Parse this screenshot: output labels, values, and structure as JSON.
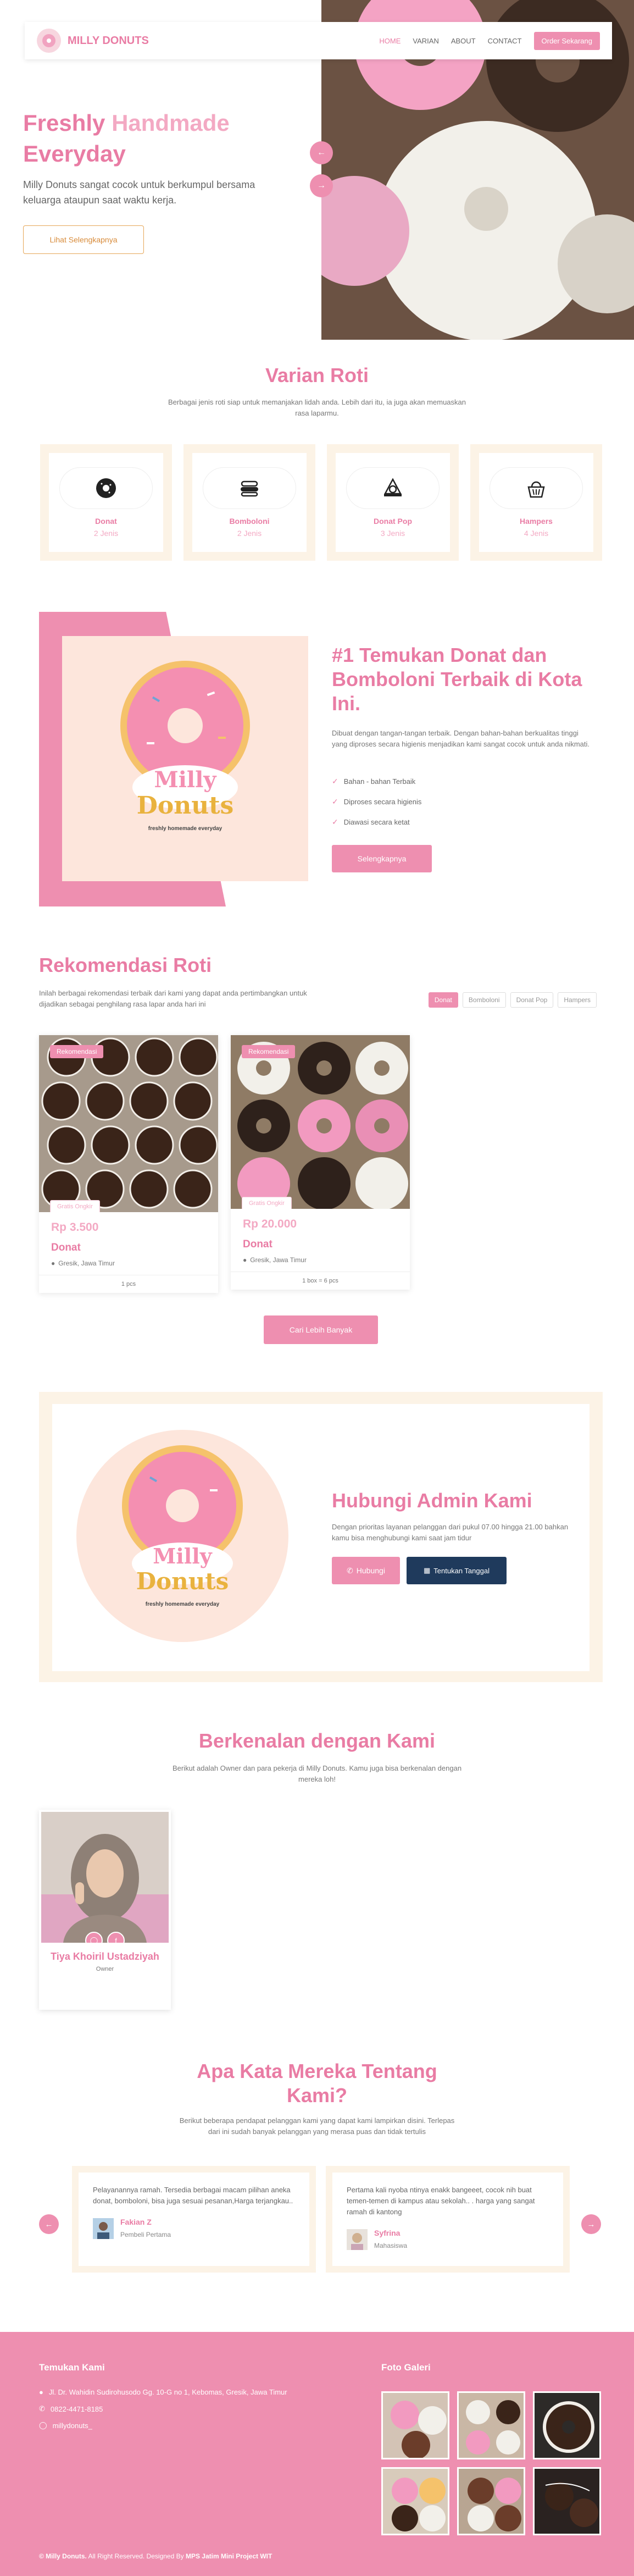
{
  "nav": {
    "brand": "MILLY DONUTS",
    "links": [
      "HOME",
      "VARIAN",
      "ABOUT",
      "CONTACT"
    ],
    "order_label": "Order Sekarang"
  },
  "hero": {
    "title_line1_a": "Freshly",
    "title_line1_b": "Handmade",
    "title_line2": "Everyday",
    "description": "Milly Donuts sangat cocok untuk berkumpul bersama keluarga ataupun saat waktu kerja.",
    "cta": "Lihat Selengkapnya"
  },
  "varian": {
    "title": "Varian Roti",
    "subtitle": "Berbagai jenis roti siap untuk memanjakan lidah anda. Lebih dari itu, ia juga akan memuaskan rasa laparmu.",
    "items": [
      {
        "name": "Donat",
        "count": "2 Jenis",
        "icon": "donut-icon"
      },
      {
        "name": "Bomboloni",
        "count": "2 Jenis",
        "icon": "bomboloni-icon"
      },
      {
        "name": "Donat Pop",
        "count": "3 Jenis",
        "icon": "donut-pop-icon"
      },
      {
        "name": "Hampers",
        "count": "4 Jenis",
        "icon": "hampers-icon"
      }
    ]
  },
  "about": {
    "heading": "#1 Temukan Donat dan Bomboloni Terbaik di Kota Ini.",
    "paragraph": "Dibuat dengan tangan-tangan terbaik. Dengan bahan-bahan berkualitas tinggi yang diproses secara higienis menjadikan kami sangat cocok untuk anda nikmati.",
    "checks": [
      "Bahan - bahan Terbaik",
      "Diproses secara higienis",
      "Diawasi secara ketat"
    ],
    "button": "Selengkapnya",
    "logo_text_1": "Milly",
    "logo_text_2": "Donuts",
    "logo_tagline": "freshly homemade everyday"
  },
  "rekomendasi": {
    "title": "Rekomendasi Roti",
    "subtitle": "Inilah berbagai rekomendasi terbaik dari kami yang dapat anda pertimbangkan untuk dijadikan sebagai penghilang rasa lapar anda hari ini",
    "filters": [
      "Donat",
      "Bomboloni",
      "Donat Pop",
      "Hampers"
    ],
    "products": [
      {
        "badge": "Rekomendasi",
        "shipping": "Gratis Ongkir",
        "price": "Rp 3.500",
        "name": "Donat",
        "location": "Gresik, Jawa Timur",
        "unit": "1 pcs"
      },
      {
        "badge": "Rekomendasi",
        "shipping": "Gratis Ongkir",
        "price": "Rp 20.000",
        "name": "Donat",
        "location": "Gresik, Jawa Timur",
        "unit": "1 box = 6 pcs"
      }
    ],
    "more": "Cari Lebih Banyak"
  },
  "contact": {
    "title": "Hubungi Admin Kami",
    "description": "Dengan prioritas layanan pelanggan dari pukul 07.00 hingga 21.00 bahkan kamu bisa menghubungi kami saat jam tidur",
    "call": "Hubungi",
    "date": "Tentukan Tanggal"
  },
  "team": {
    "title": "Berkenalan dengan Kami",
    "subtitle": "Berikut adalah Owner dan para pekerja di Milly Donuts. Kamu juga bisa berkenalan dengan mereka loh!",
    "member_name": "Tiya Khoiril Ustadziyah",
    "member_role": "Owner"
  },
  "testimonials": {
    "title_1": "Apa Kata Mereka Tentang",
    "title_2": "Kami?",
    "subtitle": "Berikut beberapa pendapat pelanggan kami yang dapat kami lampirkan disini. Terlepas dari ini sudah banyak pelanggan yang merasa puas dan tidak tertulis",
    "items": [
      {
        "text": "Pelayanannya ramah. Tersedia berbagai macam pilihan aneka donat, bomboloni, bisa juga sesuai pesanan,Harga terjangkau..",
        "name": "Fakian Z",
        "role": "Pembeli Pertama"
      },
      {
        "text": "Pertama kali nyoba ntinya enakk bangeeet, cocok nih buat temen-temen di kampus atau sekolah.. . harga yang sangat ramah di kantong",
        "name": "Syfrina",
        "role": "Mahasiswa"
      }
    ]
  },
  "footer": {
    "find_title": "Temukan Kami",
    "address": "Jl. Dr. Wahidin Sudirohusodo Gg. 10-G no 1, Kebomas, Gresik, Jawa Timur",
    "phone": "0822-4471-8185",
    "instagram": "millydonuts_",
    "gallery_title": "Foto Galeri",
    "copy_prefix": "© Milly Donuts.",
    "copy_mid": "All Right Reserved. Designed By",
    "copy_by": "MPS Jatim Mini Project WIT"
  },
  "colors": {
    "pink": "#ee8fb0",
    "cream": "#fcf3e6",
    "navy": "#1f3a5c"
  }
}
